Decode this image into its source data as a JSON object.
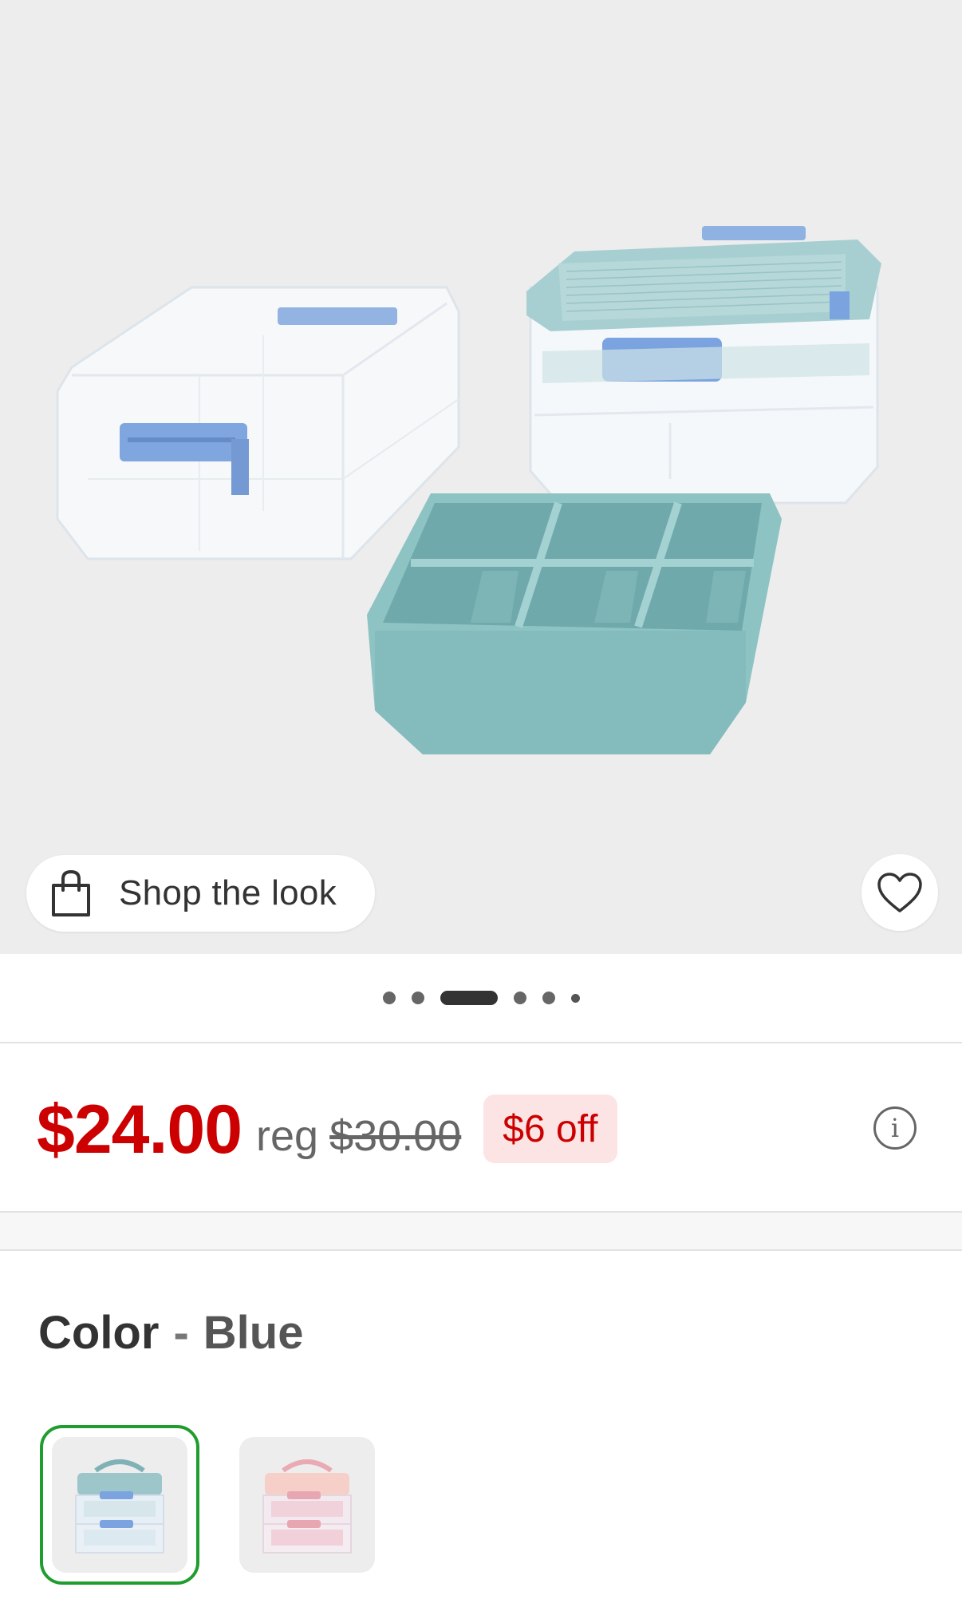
{
  "hero": {
    "shop_look_label": "Shop the look",
    "carousel_total": 6,
    "carousel_active": 3
  },
  "price": {
    "current": "$24.00",
    "reg_label": "reg",
    "regular": "$30.00",
    "discount": "$6 off"
  },
  "color": {
    "label": "Color",
    "separator": "-",
    "selected": "Blue",
    "options": [
      {
        "name": "Blue",
        "selected": true,
        "accent": "#9cc6c9"
      },
      {
        "name": "Pink",
        "selected": false,
        "accent": "#f3c6cc"
      }
    ]
  },
  "colors": {
    "price_red": "#cc0000",
    "badge_bg": "#fde4e4",
    "selected_ring": "#1f9d2e",
    "hero_bg": "#ededee"
  },
  "icons": {
    "shop": "shopping-bag-icon",
    "favorite": "heart-icon",
    "info": "info-icon"
  }
}
